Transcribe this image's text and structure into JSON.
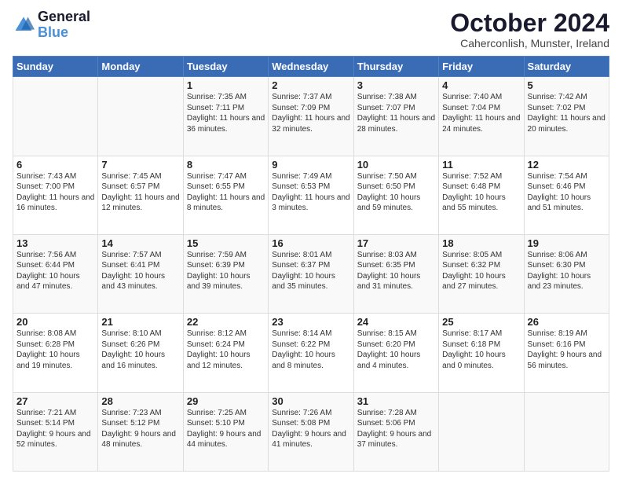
{
  "header": {
    "logo_line1": "General",
    "logo_line2": "Blue",
    "title": "October 2024",
    "subtitle": "Caherconlish, Munster, Ireland"
  },
  "weekdays": [
    "Sunday",
    "Monday",
    "Tuesday",
    "Wednesday",
    "Thursday",
    "Friday",
    "Saturday"
  ],
  "weeks": [
    [
      {
        "day": "",
        "info": ""
      },
      {
        "day": "",
        "info": ""
      },
      {
        "day": "1",
        "info": "Sunrise: 7:35 AM\nSunset: 7:11 PM\nDaylight: 11 hours and 36 minutes."
      },
      {
        "day": "2",
        "info": "Sunrise: 7:37 AM\nSunset: 7:09 PM\nDaylight: 11 hours and 32 minutes."
      },
      {
        "day": "3",
        "info": "Sunrise: 7:38 AM\nSunset: 7:07 PM\nDaylight: 11 hours and 28 minutes."
      },
      {
        "day": "4",
        "info": "Sunrise: 7:40 AM\nSunset: 7:04 PM\nDaylight: 11 hours and 24 minutes."
      },
      {
        "day": "5",
        "info": "Sunrise: 7:42 AM\nSunset: 7:02 PM\nDaylight: 11 hours and 20 minutes."
      }
    ],
    [
      {
        "day": "6",
        "info": "Sunrise: 7:43 AM\nSunset: 7:00 PM\nDaylight: 11 hours and 16 minutes."
      },
      {
        "day": "7",
        "info": "Sunrise: 7:45 AM\nSunset: 6:57 PM\nDaylight: 11 hours and 12 minutes."
      },
      {
        "day": "8",
        "info": "Sunrise: 7:47 AM\nSunset: 6:55 PM\nDaylight: 11 hours and 8 minutes."
      },
      {
        "day": "9",
        "info": "Sunrise: 7:49 AM\nSunset: 6:53 PM\nDaylight: 11 hours and 3 minutes."
      },
      {
        "day": "10",
        "info": "Sunrise: 7:50 AM\nSunset: 6:50 PM\nDaylight: 10 hours and 59 minutes."
      },
      {
        "day": "11",
        "info": "Sunrise: 7:52 AM\nSunset: 6:48 PM\nDaylight: 10 hours and 55 minutes."
      },
      {
        "day": "12",
        "info": "Sunrise: 7:54 AM\nSunset: 6:46 PM\nDaylight: 10 hours and 51 minutes."
      }
    ],
    [
      {
        "day": "13",
        "info": "Sunrise: 7:56 AM\nSunset: 6:44 PM\nDaylight: 10 hours and 47 minutes."
      },
      {
        "day": "14",
        "info": "Sunrise: 7:57 AM\nSunset: 6:41 PM\nDaylight: 10 hours and 43 minutes."
      },
      {
        "day": "15",
        "info": "Sunrise: 7:59 AM\nSunset: 6:39 PM\nDaylight: 10 hours and 39 minutes."
      },
      {
        "day": "16",
        "info": "Sunrise: 8:01 AM\nSunset: 6:37 PM\nDaylight: 10 hours and 35 minutes."
      },
      {
        "day": "17",
        "info": "Sunrise: 8:03 AM\nSunset: 6:35 PM\nDaylight: 10 hours and 31 minutes."
      },
      {
        "day": "18",
        "info": "Sunrise: 8:05 AM\nSunset: 6:32 PM\nDaylight: 10 hours and 27 minutes."
      },
      {
        "day": "19",
        "info": "Sunrise: 8:06 AM\nSunset: 6:30 PM\nDaylight: 10 hours and 23 minutes."
      }
    ],
    [
      {
        "day": "20",
        "info": "Sunrise: 8:08 AM\nSunset: 6:28 PM\nDaylight: 10 hours and 19 minutes."
      },
      {
        "day": "21",
        "info": "Sunrise: 8:10 AM\nSunset: 6:26 PM\nDaylight: 10 hours and 16 minutes."
      },
      {
        "day": "22",
        "info": "Sunrise: 8:12 AM\nSunset: 6:24 PM\nDaylight: 10 hours and 12 minutes."
      },
      {
        "day": "23",
        "info": "Sunrise: 8:14 AM\nSunset: 6:22 PM\nDaylight: 10 hours and 8 minutes."
      },
      {
        "day": "24",
        "info": "Sunrise: 8:15 AM\nSunset: 6:20 PM\nDaylight: 10 hours and 4 minutes."
      },
      {
        "day": "25",
        "info": "Sunrise: 8:17 AM\nSunset: 6:18 PM\nDaylight: 10 hours and 0 minutes."
      },
      {
        "day": "26",
        "info": "Sunrise: 8:19 AM\nSunset: 6:16 PM\nDaylight: 9 hours and 56 minutes."
      }
    ],
    [
      {
        "day": "27",
        "info": "Sunrise: 7:21 AM\nSunset: 5:14 PM\nDaylight: 9 hours and 52 minutes."
      },
      {
        "day": "28",
        "info": "Sunrise: 7:23 AM\nSunset: 5:12 PM\nDaylight: 9 hours and 48 minutes."
      },
      {
        "day": "29",
        "info": "Sunrise: 7:25 AM\nSunset: 5:10 PM\nDaylight: 9 hours and 44 minutes."
      },
      {
        "day": "30",
        "info": "Sunrise: 7:26 AM\nSunset: 5:08 PM\nDaylight: 9 hours and 41 minutes."
      },
      {
        "day": "31",
        "info": "Sunrise: 7:28 AM\nSunset: 5:06 PM\nDaylight: 9 hours and 37 minutes."
      },
      {
        "day": "",
        "info": ""
      },
      {
        "day": "",
        "info": ""
      }
    ]
  ]
}
